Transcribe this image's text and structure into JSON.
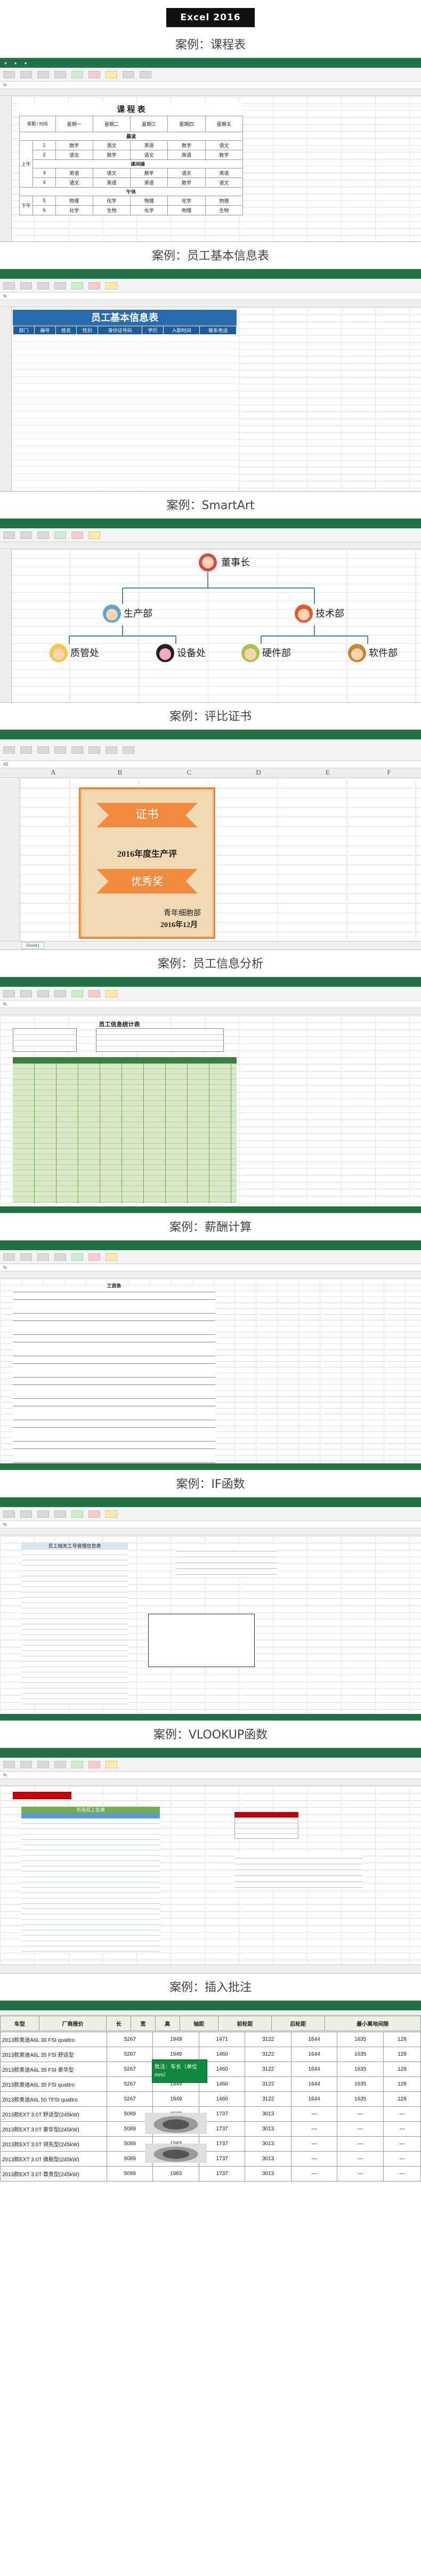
{
  "hero": "Excel 2016",
  "captions": [
    "案例：课程表",
    "案例：员工基本信息表",
    "案例：SmartArt",
    "案例：评比证书",
    "案例：员工信息分析",
    "案例：薪酬计算",
    "案例：IF函数",
    "案例：VLOOKUP函数",
    "案例：插入批注"
  ],
  "schedule": {
    "title": "课 程 表",
    "day_header": "星期",
    "time_header": "时间",
    "days": [
      "星期一",
      "星期二",
      "星期三",
      "星期四",
      "星期五"
    ],
    "morning": "上午",
    "afternoon": "下午",
    "sep_1": "晨读",
    "sep_2": "课间操",
    "sep_3": "午休",
    "rows": [
      [
        "数学",
        "语文",
        "英语",
        "数学",
        "语文"
      ],
      [
        "语文",
        "数学",
        "语文",
        "英语",
        "数学"
      ],
      [
        "英语",
        "语文",
        "数学",
        "语文",
        "英语"
      ],
      [
        "语文",
        "英语",
        "英语",
        "数学",
        "语文"
      ],
      [
        "物理",
        "化学",
        "物理",
        "化学",
        "物理"
      ],
      [
        "化学",
        "生物",
        "化学",
        "物理",
        "生物"
      ]
    ]
  },
  "staff": {
    "title": "员工基本信息表",
    "headers": [
      "部门",
      "编号",
      "姓名",
      "性别",
      "身份证号码",
      "学历",
      "入职时间",
      "联系电话"
    ]
  },
  "org": {
    "top": "董事长",
    "mid": [
      "生产部",
      "技术部"
    ],
    "bottom": [
      "质管处",
      "设备处",
      "硬件部",
      "软件部"
    ]
  },
  "certificate": {
    "ribbon_1": "证书",
    "year_line": "2016年度生产评",
    "ribbon_2": "优秀奖",
    "issuer": "青年细胞部",
    "date": "2016年12月",
    "sheet_tab": "Sheet1",
    "cols": [
      "A",
      "B",
      "C",
      "D",
      "E",
      "F"
    ]
  },
  "analysis": {
    "title": "员工信息统计表"
  },
  "salary": {
    "title": "工资条"
  },
  "iff": {
    "title": "员工相关工号管理信息表"
  },
  "vlookup": {
    "title": "市场员工名单"
  },
  "comment": {
    "headers": [
      "车型",
      "厂商报价",
      "长",
      "宽",
      "高",
      "轴距",
      "前轮距",
      "后轮距",
      "最小离地间隙"
    ],
    "rows": [
      [
        "2013款奥迪A6L 30 FSI quattro",
        "5267",
        "1949",
        "1471",
        "3122",
        "1644",
        "1635",
        "128"
      ],
      [
        "2013款奥迪A6L 35 FSI 舒适型",
        "5267",
        "1949",
        "1460",
        "3122",
        "1644",
        "1635",
        "128"
      ],
      [
        "2013款奥迪A6L 35 FSI 豪华型",
        "5267",
        "1949",
        "1460",
        "3122",
        "1644",
        "1635",
        "128"
      ],
      [
        "2013款奥迪A6L 35 FSI quattro",
        "5267",
        "1949",
        "1460",
        "3122",
        "1644",
        "1635",
        "128"
      ],
      [
        "2013款奥迪A6L 50 TFSI quattro",
        "5267",
        "1949",
        "1460",
        "3122",
        "1644",
        "1635",
        "128"
      ],
      [
        "2013款EXT 3.0T 舒适型(245kW)",
        "5089",
        "1983",
        "1737",
        "3013",
        "—",
        "—",
        "—"
      ],
      [
        "2013款EXT 3.0T 豪华型(245kW)",
        "5089",
        "1983",
        "1737",
        "3013",
        "—",
        "—",
        "—"
      ],
      [
        "2013款EXT 3.0T 领先型(245kW)",
        "5089",
        "1983",
        "1737",
        "3013",
        "—",
        "—",
        "—"
      ],
      [
        "2013款EXT 3.0T 旗舰型(245kW)",
        "5089",
        "1983",
        "1737",
        "3013",
        "—",
        "—",
        "—"
      ],
      [
        "2013款EXT 3.0T 尊贵型(245kW)",
        "5089",
        "1983",
        "1737",
        "3013",
        "—",
        "—",
        "—"
      ]
    ],
    "note": "批注：车长（单位mm）"
  },
  "colors": {
    "excel_green": "#217346",
    "header_blue": "#1f5c99",
    "cert_orange": "#f08a3c",
    "cert_bg": "#f1d9b3",
    "vlookup_red": "#c00000"
  }
}
